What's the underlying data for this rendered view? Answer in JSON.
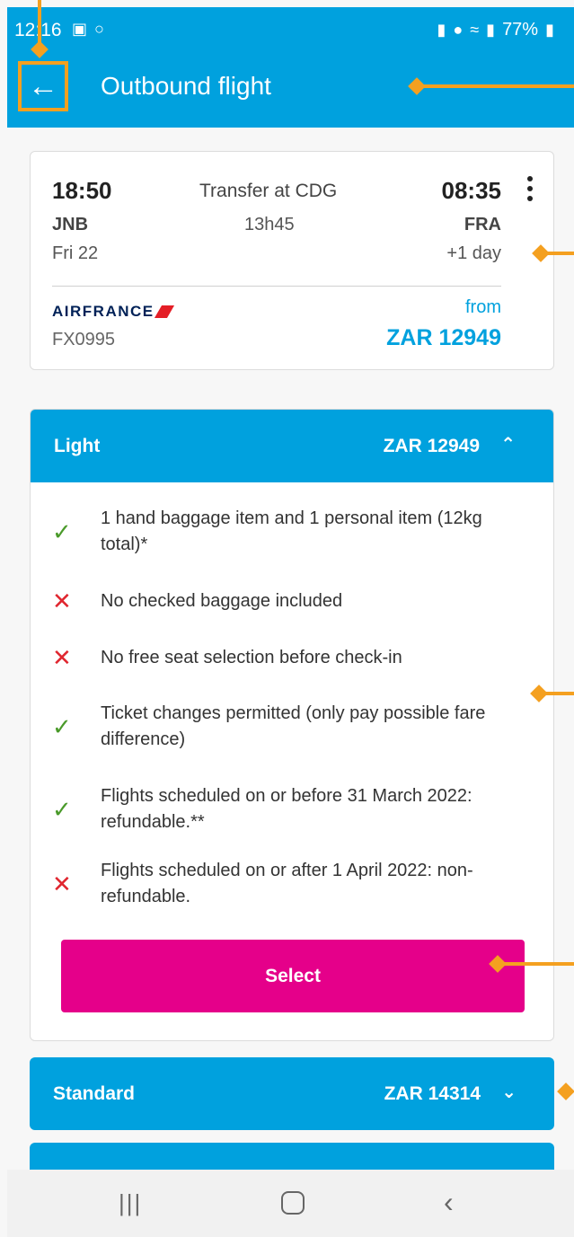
{
  "status": {
    "time": "12:16",
    "battery": "77%",
    "left_icons": [
      "image-icon",
      "circle-icon"
    ],
    "right_icons": [
      "lock-icon",
      "location-icon",
      "wifi-icon",
      "signal-icon",
      "battery-icon"
    ]
  },
  "appbar": {
    "back_icon": "arrow-left-icon",
    "title": "Outbound flight"
  },
  "flight": {
    "departure_time": "18:50",
    "transfer": "Transfer at CDG",
    "arrival_time": "08:35",
    "departure_code": "JNB",
    "duration": "13h45",
    "arrival_code": "FRA",
    "departure_date": "Fri 22",
    "arrival_date": "+1 day",
    "airline": "AIRFRANCE",
    "flight_number": "FX0995",
    "price_prefix": "from",
    "price": "ZAR 12949"
  },
  "fares": {
    "light": {
      "name": "Light",
      "price": "ZAR 12949",
      "chevron": "chevron-up-icon",
      "features": [
        {
          "ok": true,
          "text": "1 hand baggage item and 1 personal item (12kg total)*"
        },
        {
          "ok": false,
          "text": "No checked baggage included"
        },
        {
          "ok": false,
          "text": "No free seat selection before check-in"
        },
        {
          "ok": true,
          "text": "Ticket changes permitted (only pay possible fare difference)"
        },
        {
          "ok": true,
          "text": "Flights scheduled on or before 31 March 2022: refundable.**"
        },
        {
          "ok": false,
          "text": "Flights scheduled on or after 1 April 2022: non-refundable."
        }
      ],
      "select_label": "Select"
    },
    "standard": {
      "name": "Standard",
      "price": "ZAR 14314",
      "chevron": "chevron-down-icon"
    }
  },
  "colors": {
    "brand_blue": "#00a1de",
    "select_pink": "#e5008a",
    "ok_green": "#4a9a2a",
    "no_red": "#e0262f",
    "annotation": "#f4a020"
  }
}
